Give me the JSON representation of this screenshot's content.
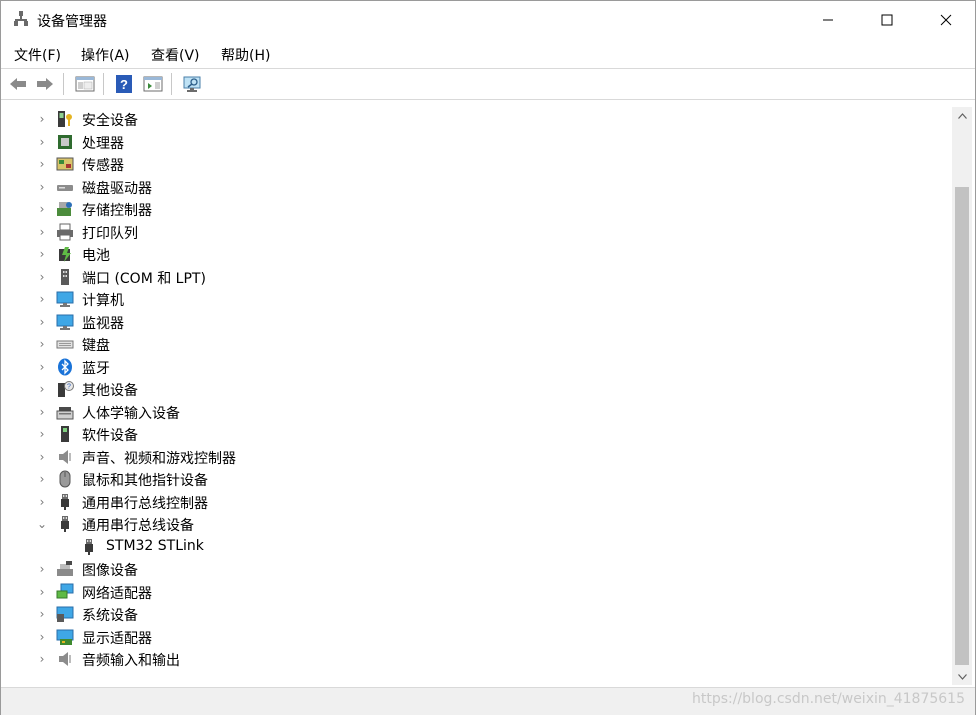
{
  "window": {
    "title": "设备管理器",
    "controls": {
      "minimize": "minimize",
      "maximize": "maximize",
      "close": "close"
    }
  },
  "menubar": {
    "items": [
      {
        "label": "文件(F)"
      },
      {
        "label": "操作(A)"
      },
      {
        "label": "查看(V)"
      },
      {
        "label": "帮助(H)"
      }
    ]
  },
  "toolbar": {
    "buttons": [
      {
        "icon": "back-arrow-icon"
      },
      {
        "icon": "forward-arrow-icon"
      },
      {
        "icon": "show-hide-console-tree-icon"
      },
      {
        "icon": "help-icon"
      },
      {
        "icon": "action-pane-icon"
      },
      {
        "icon": "scan-hardware-icon"
      }
    ]
  },
  "tree": {
    "items": [
      {
        "label": "安全设备",
        "icon": "security-device-icon",
        "expanded": false
      },
      {
        "label": "处理器",
        "icon": "processor-icon",
        "expanded": false
      },
      {
        "label": "传感器",
        "icon": "sensor-icon",
        "expanded": false
      },
      {
        "label": "磁盘驱动器",
        "icon": "disk-drive-icon",
        "expanded": false
      },
      {
        "label": "存储控制器",
        "icon": "storage-controller-icon",
        "expanded": false
      },
      {
        "label": "打印队列",
        "icon": "printer-icon",
        "expanded": false
      },
      {
        "label": "电池",
        "icon": "battery-icon",
        "expanded": false
      },
      {
        "label": "端口 (COM 和 LPT)",
        "icon": "port-icon",
        "expanded": false
      },
      {
        "label": "计算机",
        "icon": "computer-icon",
        "expanded": false
      },
      {
        "label": "监视器",
        "icon": "monitor-icon",
        "expanded": false
      },
      {
        "label": "键盘",
        "icon": "keyboard-icon",
        "expanded": false
      },
      {
        "label": "蓝牙",
        "icon": "bluetooth-icon",
        "expanded": false
      },
      {
        "label": "其他设备",
        "icon": "other-device-icon",
        "expanded": false
      },
      {
        "label": "人体学输入设备",
        "icon": "hid-icon",
        "expanded": false
      },
      {
        "label": "软件设备",
        "icon": "software-device-icon",
        "expanded": false
      },
      {
        "label": "声音、视频和游戏控制器",
        "icon": "sound-icon",
        "expanded": false
      },
      {
        "label": "鼠标和其他指针设备",
        "icon": "mouse-icon",
        "expanded": false
      },
      {
        "label": "通用串行总线控制器",
        "icon": "usb-icon",
        "expanded": false
      },
      {
        "label": "通用串行总线设备",
        "icon": "usb-icon",
        "expanded": true
      },
      {
        "label": "STM32 STLink",
        "icon": "usb-icon",
        "child": true
      },
      {
        "label": "图像设备",
        "icon": "imaging-device-icon",
        "expanded": false
      },
      {
        "label": "网络适配器",
        "icon": "network-adapter-icon",
        "expanded": false
      },
      {
        "label": "系统设备",
        "icon": "system-device-icon",
        "expanded": false
      },
      {
        "label": "显示适配器",
        "icon": "display-adapter-icon",
        "expanded": false
      },
      {
        "label": "音频输入和输出",
        "icon": "audio-io-icon",
        "expanded": false
      }
    ]
  },
  "statusbar": {
    "watermark": "https://blog.csdn.net/weixin_41875615"
  }
}
